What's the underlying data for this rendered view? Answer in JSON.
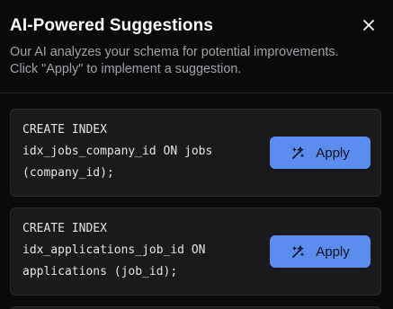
{
  "dialog": {
    "title": "AI-Powered Suggestions",
    "description": "Our AI analyzes your schema for potential improvements. Click \"Apply\" to implement a suggestion.",
    "close_icon": "close-icon"
  },
  "suggestions": [
    {
      "code": "CREATE INDEX\nidx_jobs_company_id ON jobs\n(company_id);",
      "apply_label": "Apply",
      "icon": "sparkle-wand-icon"
    },
    {
      "code": "CREATE INDEX\nidx_applications_job_id ON\napplications (job_id);",
      "apply_label": "Apply",
      "icon": "sparkle-wand-icon"
    }
  ],
  "colors": {
    "background": "#0a0a0a",
    "card": "#1a1a1c",
    "accent": "#5b8def"
  }
}
